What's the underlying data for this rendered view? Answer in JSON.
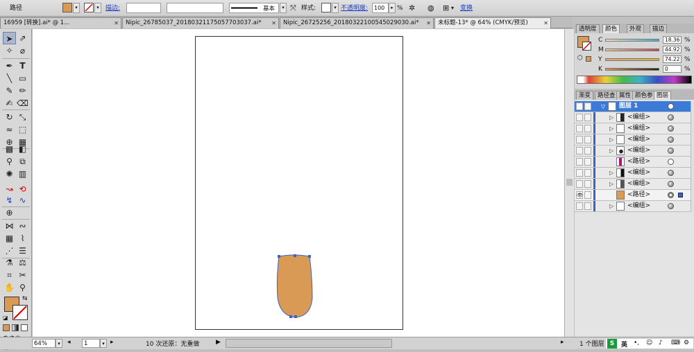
{
  "control_bar": {
    "object_type": "路径",
    "stroke_label": "描边:",
    "stroke_profile": "基本",
    "style_label": "样式:",
    "opacity_label": "不透明度:",
    "opacity_value": "100",
    "opacity_unit": "%",
    "transform_label": "变换"
  },
  "doc_tabs": [
    {
      "label": "16959 [转换].ai* @ 1..."
    },
    {
      "label": "Nipic_26785037_20180321175057703037.ai*"
    },
    {
      "label": "Nipic_26725256_20180322100545029030.ai*"
    },
    {
      "label": "未标题-13* @ 64% (CMYK/预览)"
    }
  ],
  "color_panel": {
    "tabs": [
      "透明度",
      "颜色",
      "外观",
      "描边"
    ],
    "channels": [
      {
        "name": "C",
        "value": "18.36",
        "unit": "%"
      },
      {
        "name": "M",
        "value": "44.92",
        "unit": "%"
      },
      {
        "name": "Y",
        "value": "74.22",
        "unit": "%"
      },
      {
        "name": "K",
        "value": "0",
        "unit": "%"
      }
    ]
  },
  "layers_panel": {
    "tabs": [
      "渐变",
      "路径查",
      "属性",
      "颜色参",
      "图层"
    ],
    "top_layer": "图层 1",
    "rows": [
      {
        "name": "<编组>"
      },
      {
        "name": "<编组>"
      },
      {
        "name": "<编组>"
      },
      {
        "name": "<编组>"
      },
      {
        "name": "<路径>"
      },
      {
        "name": "<编组>"
      },
      {
        "name": "<编组>"
      },
      {
        "name": "<路径>"
      },
      {
        "name": "<编组>"
      }
    ],
    "footer": "1 个图层"
  },
  "status_bar": {
    "zoom": "64%",
    "artboard": "1",
    "undo_text": "10 次还原：无重做"
  },
  "ime": {
    "label": "英"
  },
  "colors": {
    "fill": "#d99a55",
    "selection": "#3b63c9"
  }
}
